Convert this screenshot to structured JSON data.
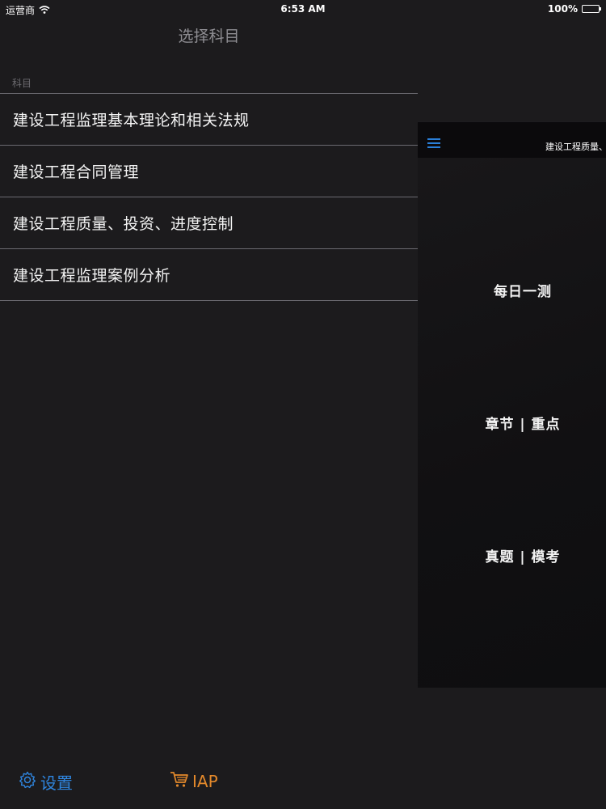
{
  "status_bar": {
    "carrier": "运营商",
    "time": "6:53 AM",
    "battery": "100%"
  },
  "master": {
    "title": "选择科目",
    "section_header": "科目",
    "items": [
      {
        "label": "建设工程监理基本理论和相关法规"
      },
      {
        "label": "建设工程合同管理"
      },
      {
        "label": "建设工程质量、投资、进度控制"
      },
      {
        "label": "建设工程监理案例分析"
      }
    ]
  },
  "toolbar": {
    "settings_label": "设置",
    "iap_label": "IAP"
  },
  "detail": {
    "title": "建设工程质量、",
    "buttons": [
      {
        "label": "每日一测"
      },
      {
        "label": "章节 | 重点"
      },
      {
        "label": "真题 | 模考"
      }
    ]
  },
  "colors": {
    "accent_blue": "#2f86e0",
    "accent_orange": "#e3892b",
    "background": "#1c1b1d"
  }
}
